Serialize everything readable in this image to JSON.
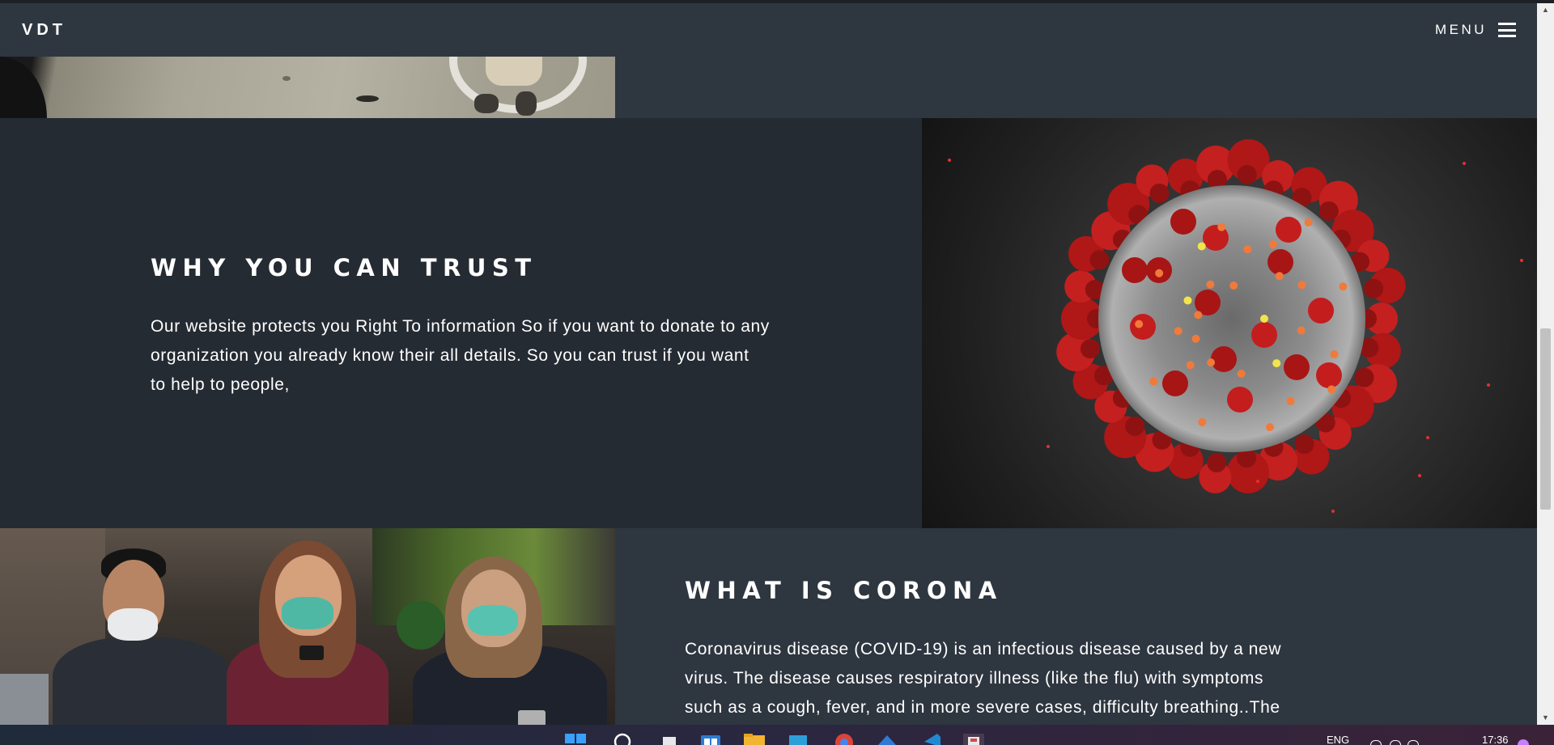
{
  "navbar": {
    "brand": "VDT",
    "menu_label": "MENU"
  },
  "trust": {
    "heading": "WHY YOU CAN TRUST",
    "paragraph_lines": [
      "Our website protects you Right To information So if you want to donate to any",
      "organization you already know their all details. So you can trust if you want",
      "to help to people,"
    ]
  },
  "corona": {
    "heading": "WHAT IS CORONA",
    "paragraph_lines": [
      "Coronavirus disease (COVID-19) is an infectious disease caused by a new",
      "virus. The disease causes respiratory illness (like the flu) with symptoms",
      "such as a cough, fever, and in more severe cases, difficulty breathing..The"
    ]
  },
  "images": {
    "top": "pavement-photo",
    "virus": "coronavirus-illustration",
    "people": "masked-people-photo"
  },
  "taskbar": {
    "language": "ENG",
    "time": "17:36",
    "icons": [
      "windows-start-icon",
      "search-icon",
      "task-view-icon",
      "widgets-icon",
      "file-explorer-icon",
      "store-icon",
      "chrome-icon",
      "app-icon",
      "vscode-icon",
      "vscode-icon",
      "active-app-icon"
    ]
  },
  "colors": {
    "navbar": "#2e3740",
    "section_dark": "#252b33",
    "section_mid": "#2e3640",
    "text": "#ffffff"
  }
}
